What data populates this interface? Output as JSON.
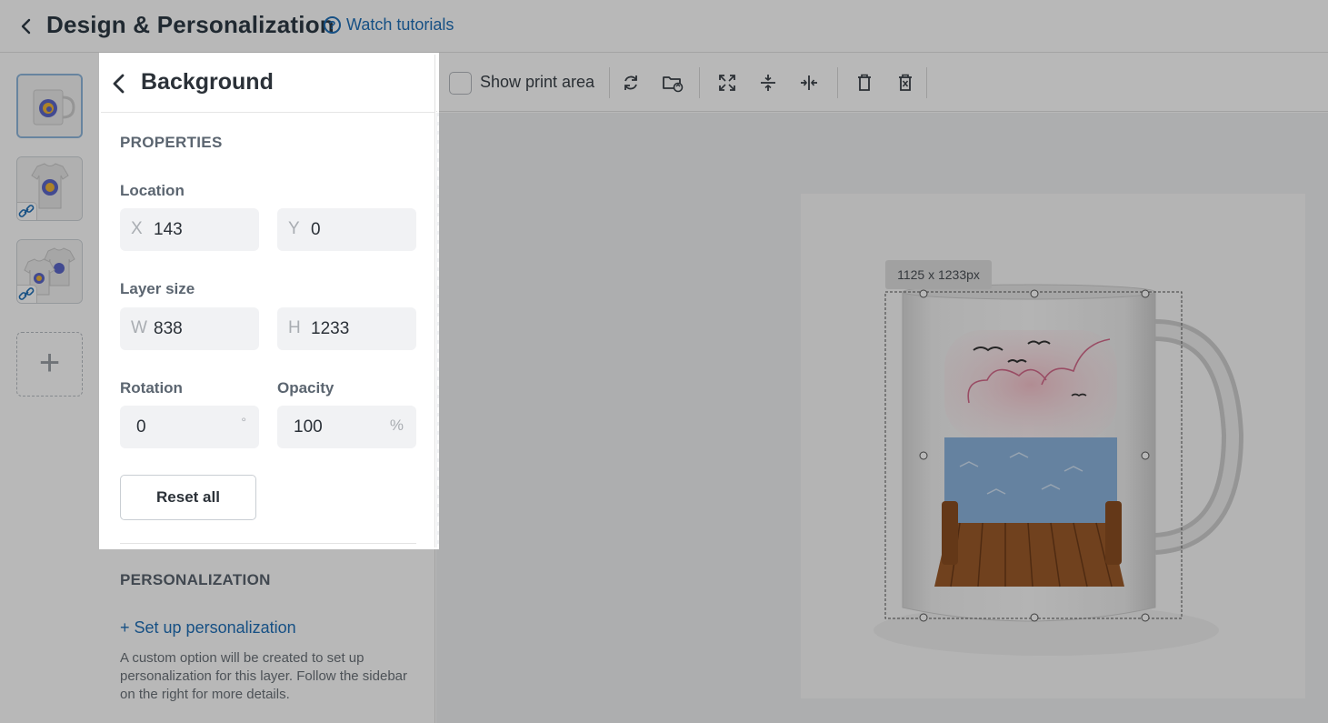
{
  "header": {
    "title": "Design & Personalization",
    "tutorial_label": "Watch tutorials"
  },
  "panel": {
    "title": "Background",
    "properties_heading": "PROPERTIES",
    "location": {
      "label": "Location",
      "x_prefix": "X",
      "x": "143",
      "y_prefix": "Y",
      "y": "0"
    },
    "layer_size": {
      "label": "Layer size",
      "w_prefix": "W",
      "w": "838",
      "h_prefix": "H",
      "h": "1233"
    },
    "rotation": {
      "label": "Rotation",
      "value": "0",
      "unit": "°"
    },
    "opacity": {
      "label": "Opacity",
      "value": "100",
      "unit": "%"
    },
    "reset_label": "Reset all",
    "personalization_heading": "PERSONALIZATION",
    "setup_link": "+ Set up personalization",
    "help_text": "A custom option will be created to set up personalization for this layer. Follow the sidebar on the right for more details."
  },
  "toolbar": {
    "show_print_area_label": "Show print area",
    "show_print_area_checked": false,
    "icons": [
      "rotate-icon",
      "replace-image-icon",
      "fit-to-print-area-icon",
      "align-vertical-center-icon",
      "align-horizontal-center-icon",
      "delete-layer-icon",
      "clear-all-icon"
    ]
  },
  "canvas": {
    "size_label": "1125 x 1233px"
  },
  "thumbnails": [
    {
      "name": "mug-thumbnail",
      "active": true,
      "linked": false
    },
    {
      "name": "tshirt-thumbnail",
      "active": false,
      "linked": true
    },
    {
      "name": "tshirt-pair-thumbnail",
      "active": false,
      "linked": true
    }
  ],
  "add_thumbnail_icon": "plus-icon",
  "colors": {
    "link": "#1f6fb8",
    "title": "#2d3a45",
    "field_bg": "#f1f2f4",
    "overlay": "rgba(0,0,0,0.28)"
  }
}
